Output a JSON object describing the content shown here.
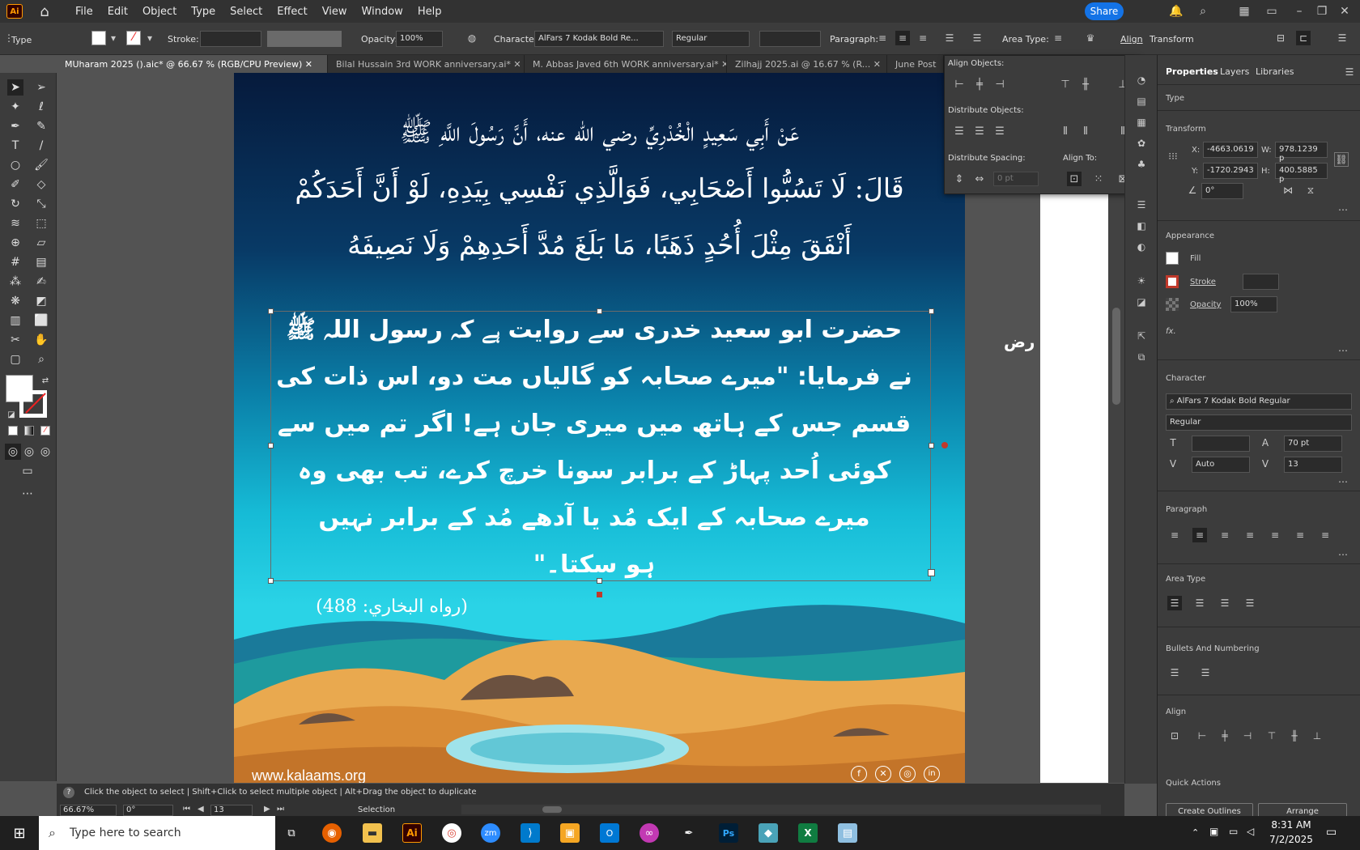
{
  "menubar": {
    "logo": "Ai",
    "items": [
      "File",
      "Edit",
      "Object",
      "Type",
      "Select",
      "Effect",
      "View",
      "Window",
      "Help"
    ],
    "share": "Share"
  },
  "control_bar": {
    "tool_label": "Type",
    "stroke_label": "Stroke:",
    "opacity_label": "Opacity:",
    "opacity_value": "100%",
    "character_label": "Character:",
    "font_name": "AlFars 7 Kodak Bold Re...",
    "font_style": "Regular",
    "paragraph_label": "Paragraph:",
    "area_type_label": "Area Type:",
    "align_label": "Align",
    "transform_label": "Transform"
  },
  "tabs": [
    {
      "label": "MUharam 2025 ().aic* @ 66.67 % (RGB/CPU Preview)",
      "active": true
    },
    {
      "label": "Bilal Hussain  3rd  WORK anniversary.ai*"
    },
    {
      "label": "M. Abbas Javed  6th  WORK anniversary.ai*"
    },
    {
      "label": "Zilhajj 2025.ai @ 16.67 % (R..."
    },
    {
      "label": "June Post"
    }
  ],
  "artwork": {
    "arabic_lines": [
      "عَنْ أَبِي سَعِيدٍ الْخُدْرِيِّ رضي الله عنه، أَنَّ رَسُولَ اللَّهِ ﷺ",
      "قَالَ: لَا تَسُبُّوا أَصْحَابِي، فَوَالَّذِي نَفْسِي بِيَدِهِ، لَوْ أَنَّ أَحَدَكُمْ",
      "أَنْفَقَ مِثْلَ أُحُدٍ ذَهَبًا، مَا بَلَغَ مُدَّ أَحَدِهِمْ وَلَا نَصِيفَهُ"
    ],
    "urdu_lines": [
      "حضرت ابو سعید خدری سے روایت ہے کہ رسول اللہ ﷺ",
      "نے فرمایا: \"میرے صحابہ کو گالیاں مت دو، اس ذات کی",
      "قسم جس کے ہاتھ میں میری جان ہے! اگر تم میں سے",
      "کوئی اُحد پہاڑ کے برابر سونا خرچ کرے، تب بھی وہ",
      "میرے صحابہ کے ایک مُد یا آدھے مُد کے برابر نہیں",
      "ہو سکتا۔\""
    ],
    "reference": "(رواه البخاري: 488)",
    "website": "www.kalaams.org",
    "floating_glyph": "رض"
  },
  "align_popup": {
    "align_objects": "Align Objects:",
    "distribute_objects": "Distribute Objects:",
    "distribute_spacing": "Distribute Spacing:",
    "align_to": "Align To:",
    "spacing_value": "0 pt"
  },
  "properties": {
    "tabs": [
      "Properties",
      "Layers",
      "Libraries"
    ],
    "type_heading": "Type",
    "transform_heading": "Transform",
    "x_label": "X:",
    "x_value": "-4663.0619",
    "y_label": "Y:",
    "y_value": "-1720.2943",
    "w_label": "W:",
    "w_value": "978.1239 p",
    "h_label": "H:",
    "h_value": "400.5885 p",
    "rotate_value": "0°",
    "appearance_heading": "Appearance",
    "fill_label": "Fill",
    "stroke_label": "Stroke",
    "opacity_label": "Opacity",
    "opacity_value": "100%",
    "fx_label": "fx.",
    "character_heading": "Character",
    "font": "AlFars 7 Kodak Bold Regular",
    "font_style": "Regular",
    "font_size": "70 pt",
    "tracking": "Auto",
    "kerning": "13",
    "paragraph_heading": "Paragraph",
    "area_type_heading": "Area Type",
    "bullets_heading": "Bullets And Numbering",
    "align_heading": "Align",
    "quick_actions_heading": "Quick Actions",
    "create_outlines": "Create Outlines",
    "arrange": "Arrange"
  },
  "statusbar": {
    "hint": "Click the object to select  |  Shift+Click to select multiple object  |  Alt+Drag the object to duplicate",
    "zoom": "66.67%",
    "rotation": "0°",
    "artboard_num": "13",
    "mode": "Selection"
  },
  "taskbar": {
    "search_placeholder": "Type here to search",
    "time": "8:31 AM",
    "date": "7/2/2025"
  },
  "colors": {
    "accent": "#1473e6",
    "ai_brand": "#ff9a00"
  }
}
